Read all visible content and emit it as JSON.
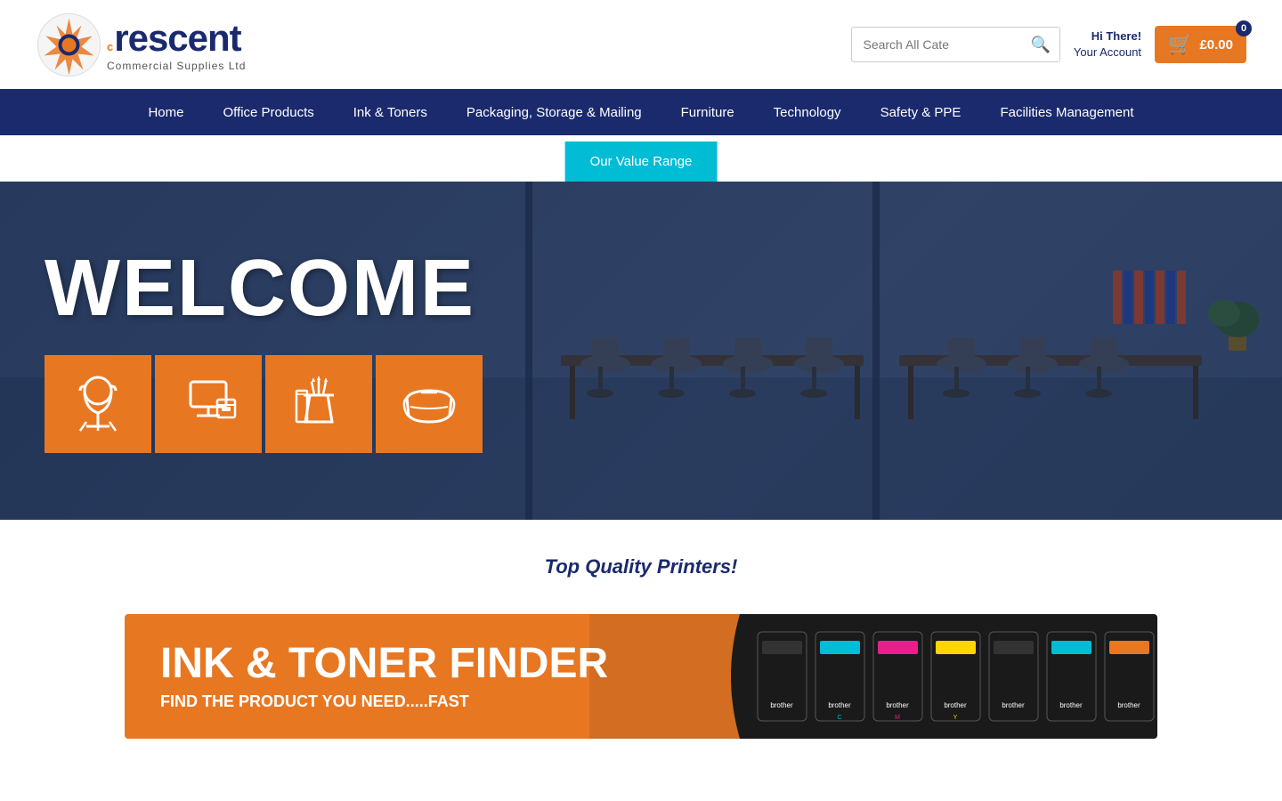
{
  "header": {
    "logo": {
      "brand_name": "rescent",
      "tagline": "Commercial Supplies Ltd"
    },
    "search": {
      "placeholder": "Search All Cate",
      "button_label": "🔍"
    },
    "account": {
      "greeting": "Hi There!",
      "link_text": "Your Account"
    },
    "cart": {
      "price": "£0.00",
      "count": "0"
    }
  },
  "nav": {
    "items": [
      {
        "label": "Home",
        "id": "home"
      },
      {
        "label": "Office Products",
        "id": "office-products"
      },
      {
        "label": "Ink & Toners",
        "id": "ink-toners"
      },
      {
        "label": "Packaging, Storage & Mailing",
        "id": "packaging"
      },
      {
        "label": "Furniture",
        "id": "furniture"
      },
      {
        "label": "Technology",
        "id": "technology"
      },
      {
        "label": "Safety & PPE",
        "id": "safety-ppe"
      },
      {
        "label": "Facilities Management",
        "id": "facilities"
      }
    ],
    "value_range_label": "Our Value Range"
  },
  "hero": {
    "welcome_text": "WELCOME",
    "icons": [
      {
        "id": "chair",
        "symbol": "🪑"
      },
      {
        "id": "desk",
        "symbol": "🖥"
      },
      {
        "id": "stationery",
        "symbol": "📚"
      },
      {
        "id": "mask",
        "symbol": "😷"
      }
    ]
  },
  "subtitle": {
    "text": "Top Quality Printers!"
  },
  "ink_banner": {
    "title": "INK & TONER FINDER",
    "subtitle": "FIND THE PRODUCT YOU NEED.....FAST"
  }
}
